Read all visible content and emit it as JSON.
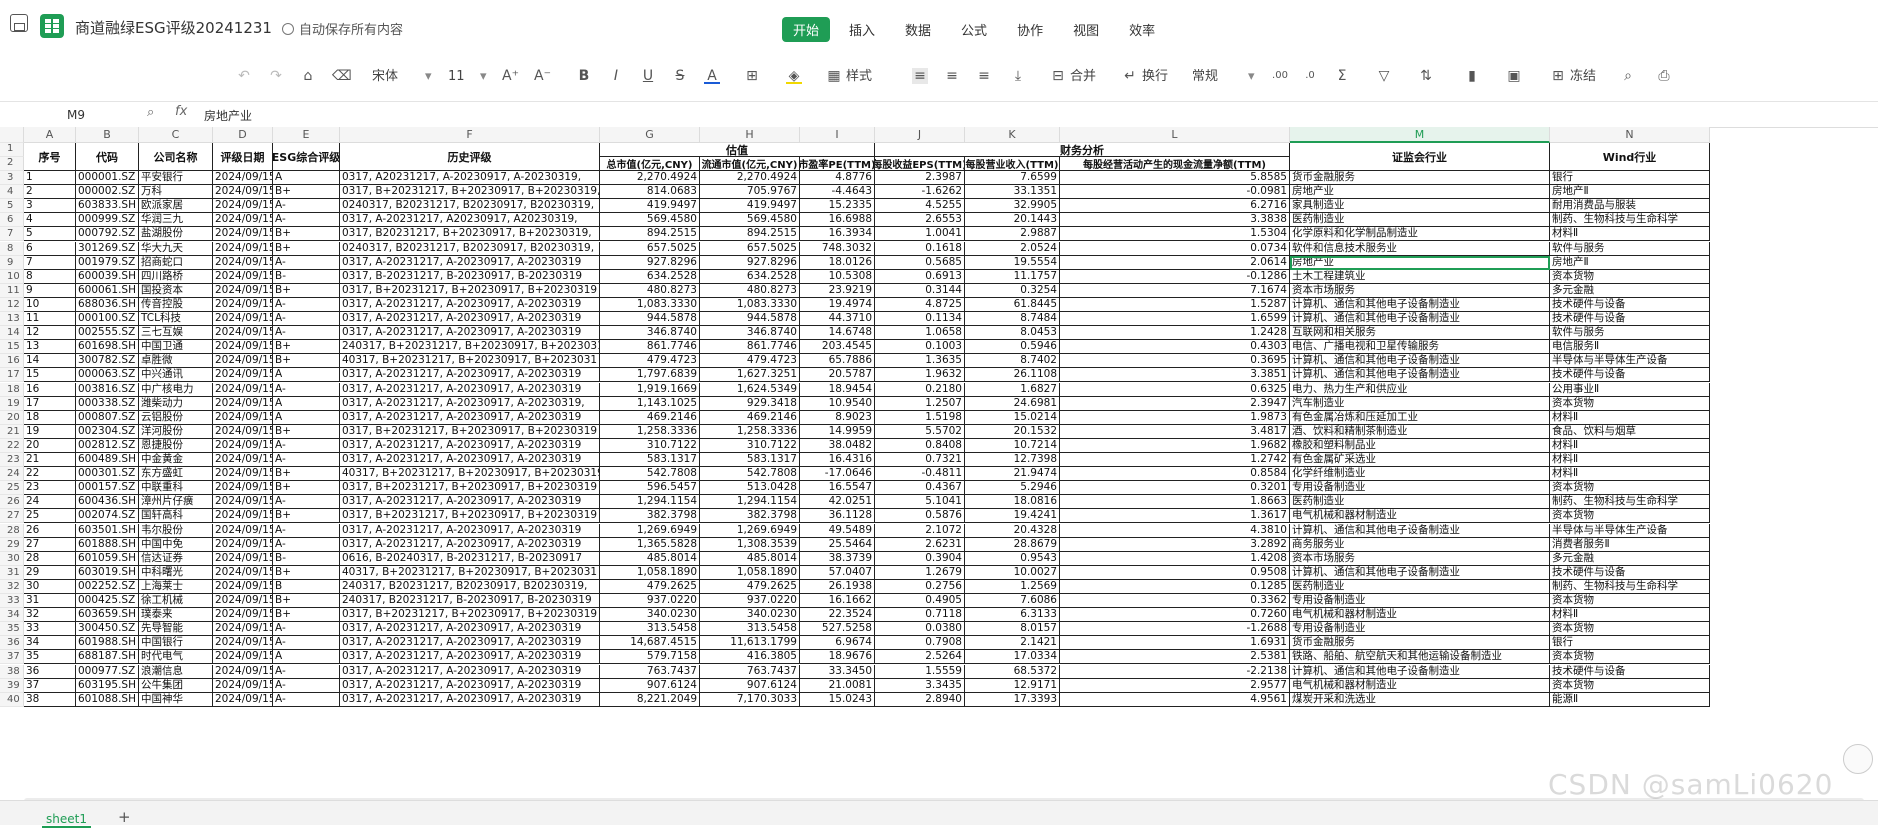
{
  "app": {
    "title": "商道融绿ESG评级20241231",
    "autosave": "自动保存所有内容"
  },
  "menus": [
    "开始",
    "插入",
    "数据",
    "公式",
    "协作",
    "视图",
    "效率"
  ],
  "toolbar": {
    "font": "宋体",
    "size": "11",
    "style": "样式",
    "merge": "合并",
    "wrap": "换行",
    "numfmt": "常规",
    "freeze": "冻结"
  },
  "formula": {
    "cell": "M9",
    "value": "房地产业"
  },
  "sheet": {
    "tab": "sheet1"
  },
  "watermark": "CSDN @samLi0620",
  "columns": [
    "A",
    "B",
    "C",
    "D",
    "E",
    "F",
    "G",
    "H",
    "I",
    "J",
    "K",
    "L",
    "M",
    "N"
  ],
  "group_headers": {
    "valuation": "估值",
    "finance": "财务分析"
  },
  "headers": [
    "序号",
    "代码",
    "公司名称",
    "评级日期",
    "ESG综合评级",
    "历史评级",
    "总市值(亿元,CNY)",
    "流通市值(亿元,CNY)",
    "市盈率PE(TTM)",
    "每股收益EPS(TTM)",
    "每股营业收入(TTM)",
    "每股经营活动产生的现金流量净额(TTM)",
    "证监会行业",
    "Wind行业"
  ],
  "rows": [
    [
      "1",
      "000001.SZ",
      "平安银行",
      "2024/09/15",
      "A",
      "0317, A20231217, A-20230917, A-20230319,",
      "2,270.4924",
      "2,270.4924",
      "4.8776",
      "2.3987",
      "7.6599",
      "5.8585",
      "货币金融服务",
      "银行"
    ],
    [
      "2",
      "000002.SZ",
      "万科",
      "2024/09/15",
      "B+",
      "0317, B+20231217, B+20230917, B+20230319,",
      "814.0683",
      "705.9767",
      "-4.4643",
      "-1.6262",
      "33.1351",
      "-0.0981",
      "房地产业",
      "房地产Ⅱ"
    ],
    [
      "3",
      "603833.SH",
      "欧派家居",
      "2024/09/15",
      "A-",
      "0240317, B20231217, B20230917, B20230319,",
      "419.9497",
      "419.9497",
      "15.2335",
      "4.5255",
      "32.9905",
      "6.2716",
      "家具制造业",
      "耐用消费品与服装"
    ],
    [
      "4",
      "000999.SZ",
      "华润三九",
      "2024/09/15",
      "A-",
      "0317, A-20231217, A20230917, A20230319,",
      "569.4580",
      "569.4580",
      "16.6988",
      "2.6553",
      "20.1443",
      "3.3838",
      "医药制造业",
      "制药、生物科技与生命科学"
    ],
    [
      "5",
      "000792.SZ",
      "盐湖股份",
      "2024/09/15",
      "B+",
      "0317, B20231217, B+20230917, B+20230319,",
      "894.2515",
      "894.2515",
      "16.3934",
      "1.0041",
      "2.9887",
      "1.5304",
      "化学原料和化学制品制造业",
      "材料Ⅱ"
    ],
    [
      "6",
      "301269.SZ",
      "华大九天",
      "2024/09/15",
      "B+",
      "0240317, B20231217, B20230917, B20230319,",
      "657.5025",
      "657.5025",
      "748.3032",
      "0.1618",
      "2.0524",
      "0.0734",
      "软件和信息技术服务业",
      "软件与服务"
    ],
    [
      "7",
      "001979.SZ",
      "招商蛇口",
      "2024/09/15",
      "A-",
      "0317, A-20231217, A-20230917, A-20230319",
      "927.8296",
      "927.8296",
      "18.0126",
      "0.5685",
      "19.5554",
      "2.0614",
      "房地产业",
      "房地产Ⅱ"
    ],
    [
      "8",
      "600039.SH",
      "四川路桥",
      "2024/09/15",
      "B-",
      "0317, B-20231217, B-20230917, B-20230319",
      "634.2528",
      "634.2528",
      "10.5308",
      "0.6913",
      "11.1757",
      "-0.1286",
      "土木工程建筑业",
      "资本货物"
    ],
    [
      "9",
      "600061.SH",
      "国投资本",
      "2024/09/15",
      "B+",
      "0317, B+20231217, B+20230917, B+20230319",
      "480.8273",
      "480.8273",
      "23.9219",
      "0.3144",
      "0.3254",
      "7.1674",
      "资本市场服务",
      "多元金融"
    ],
    [
      "10",
      "688036.SH",
      "传音控股",
      "2024/09/15",
      "A-",
      "0317, A-20231217, A-20230917, A-20230319",
      "1,083.3330",
      "1,083.3330",
      "19.4974",
      "4.8725",
      "61.8445",
      "1.5287",
      "计算机、通信和其他电子设备制造业",
      "技术硬件与设备"
    ],
    [
      "11",
      "000100.SZ",
      "TCL科技",
      "2024/09/15",
      "A-",
      "0317, A-20231217, A-20230917, A-20230319",
      "944.5878",
      "944.5878",
      "44.3710",
      "0.1134",
      "8.7484",
      "1.6599",
      "计算机、通信和其他电子设备制造业",
      "技术硬件与设备"
    ],
    [
      "12",
      "002555.SZ",
      "三七互娱",
      "2024/09/15",
      "A-",
      "0317, A-20231217, A-20230917, A-20230319",
      "346.8740",
      "346.8740",
      "14.6748",
      "1.0658",
      "8.0453",
      "1.2428",
      "互联网和相关服务",
      "软件与服务"
    ],
    [
      "13",
      "601698.SH",
      "中国卫通",
      "2024/09/15",
      "B+",
      "240317, B+20231217, B+20230917, B+20230319",
      "861.7746",
      "861.7746",
      "203.4545",
      "0.1003",
      "0.5946",
      "0.4303",
      "电信、广播电视和卫星传输服务",
      "电信服务Ⅱ"
    ],
    [
      "14",
      "300782.SZ",
      "卓胜微",
      "2024/09/15",
      "B+",
      "40317, B+20231217, B+20230917, B+2023031",
      "479.4723",
      "479.4723",
      "65.7886",
      "1.3635",
      "8.7402",
      "0.3695",
      "计算机、通信和其他电子设备制造业",
      "半导体与半导体生产设备"
    ],
    [
      "15",
      "000063.SZ",
      "中兴通讯",
      "2024/09/15",
      "A",
      "0317, A-20231217, A-20230917, A-20230319",
      "1,797.6839",
      "1,627.3251",
      "20.5787",
      "1.9632",
      "26.1108",
      "3.3851",
      "计算机、通信和其他电子设备制造业",
      "技术硬件与设备"
    ],
    [
      "16",
      "003816.SZ",
      "中广核电力",
      "2024/09/15",
      "A-",
      "0317, A-20231217, A-20230917, A-20230319",
      "1,919.1669",
      "1,624.5349",
      "18.9454",
      "0.2180",
      "1.6827",
      "0.6325",
      "电力、热力生产和供应业",
      "公用事业Ⅱ"
    ],
    [
      "17",
      "000338.SZ",
      "潍柴动力",
      "2024/09/15",
      "A",
      "0317, A-20231217, A-20230917, A-20230319,",
      "1,143.1025",
      "929.3418",
      "10.9540",
      "1.2507",
      "24.6981",
      "2.3947",
      "汽车制造业",
      "资本货物"
    ],
    [
      "18",
      "000807.SZ",
      "云铝股份",
      "2024/09/15",
      "A",
      "0317, A-20231217, A-20230917, A-20230319",
      "469.2146",
      "469.2146",
      "8.9023",
      "1.5198",
      "15.0214",
      "1.9873",
      "有色金属冶炼和压延加工业",
      "材料Ⅱ"
    ],
    [
      "19",
      "002304.SZ",
      "洋河股份",
      "2024/09/15",
      "B+",
      "0317, B+20231217, B+20230917, B+20230319",
      "1,258.3336",
      "1,258.3336",
      "14.9959",
      "5.5702",
      "20.1532",
      "3.4817",
      "酒、饮料和精制茶制造业",
      "食品、饮料与烟草"
    ],
    [
      "20",
      "002812.SZ",
      "恩捷股份",
      "2024/09/15",
      "A-",
      "0317, A-20231217, A-20230917, A-20230319",
      "310.7122",
      "310.7122",
      "38.0482",
      "0.8408",
      "10.7214",
      "1.9682",
      "橡胶和塑料制品业",
      "材料Ⅱ"
    ],
    [
      "21",
      "600489.SH",
      "中金黄金",
      "2024/09/15",
      "A-",
      "0317, A-20231217, A-20230917, A-20230319",
      "583.1317",
      "583.1317",
      "16.4316",
      "0.7321",
      "12.7398",
      "1.2742",
      "有色金属矿采选业",
      "材料Ⅱ"
    ],
    [
      "22",
      "000301.SZ",
      "东方盛虹",
      "2024/09/15",
      "B+",
      "40317, B+20231217, B+20230917, B+20230319",
      "542.7808",
      "542.7808",
      "-17.0646",
      "-0.4811",
      "21.9474",
      "0.8584",
      "化学纤维制造业",
      "材料Ⅱ"
    ],
    [
      "23",
      "000157.SZ",
      "中联重科",
      "2024/09/15",
      "B+",
      "0317, B+20231217, B+20230917, B+20230319",
      "596.5457",
      "513.0428",
      "16.5547",
      "0.4367",
      "5.2946",
      "0.3201",
      "专用设备制造业",
      "资本货物"
    ],
    [
      "24",
      "600436.SH",
      "漳州片仔癀",
      "2024/09/15",
      "A-",
      "0317, A-20231217, A-20230917, A-20230319",
      "1,294.1154",
      "1,294.1154",
      "42.0251",
      "5.1041",
      "18.0816",
      "1.8663",
      "医药制造业",
      "制药、生物科技与生命科学"
    ],
    [
      "25",
      "002074.SZ",
      "国轩高科",
      "2024/09/15",
      "B+",
      "0317, B+20231217, B+20230917, B+20230319",
      "382.3798",
      "382.3798",
      "36.1128",
      "0.5876",
      "19.4241",
      "1.3617",
      "电气机械和器材制造业",
      "资本货物"
    ],
    [
      "26",
      "603501.SH",
      "韦尔股份",
      "2024/09/15",
      "A-",
      "0317, A-20231217, A-20230917, A-20230319",
      "1,269.6949",
      "1,269.6949",
      "49.5489",
      "2.1072",
      "20.4328",
      "4.3810",
      "计算机、通信和其他电子设备制造业",
      "半导体与半导体生产设备"
    ],
    [
      "27",
      "601888.SH",
      "中国中免",
      "2024/09/15",
      "A-",
      "0317, A-20231217, A-20230917, A-20230319",
      "1,365.5828",
      "1,308.3539",
      "25.5464",
      "2.6231",
      "28.8679",
      "3.2892",
      "商务服务业",
      "消费者服务Ⅱ"
    ],
    [
      "28",
      "601059.SH",
      "信达证券",
      "2024/09/15",
      "B-",
      "0616, B-20240317, B-20231217, B-20230917",
      "485.8014",
      "485.8014",
      "38.3739",
      "0.3904",
      "0.9543",
      "1.4208",
      "资本市场服务",
      "多元金融"
    ],
    [
      "29",
      "603019.SH",
      "中科曙光",
      "2024/09/15",
      "B+",
      "40317, B+20231217, B+20230917, B+2023031",
      "1,058.1890",
      "1,058.1890",
      "57.0407",
      "1.2679",
      "10.0027",
      "0.9508",
      "计算机、通信和其他电子设备制造业",
      "技术硬件与设备"
    ],
    [
      "30",
      "002252.SZ",
      "上海莱士",
      "2024/09/15",
      "B",
      "240317, B20231217, B20230917, B20230319,",
      "479.2625",
      "479.2625",
      "26.1938",
      "0.2756",
      "1.2569",
      "0.1285",
      "医药制造业",
      "制药、生物科技与生命科学"
    ],
    [
      "31",
      "000425.SZ",
      "徐工机械",
      "2024/09/15",
      "B+",
      "240317, B20231217, B-20230917, B-20230319",
      "937.0220",
      "937.0220",
      "16.1662",
      "0.4905",
      "7.6086",
      "0.3362",
      "专用设备制造业",
      "资本货物"
    ],
    [
      "32",
      "603659.SH",
      "璞泰来",
      "2024/09/15",
      "B+",
      "0317, B+20231217, B+20230917, B+20230319",
      "340.0230",
      "340.0230",
      "22.3524",
      "0.7118",
      "6.3133",
      "0.7260",
      "电气机械和器材制造业",
      "材料Ⅱ"
    ],
    [
      "33",
      "300450.SZ",
      "先导智能",
      "2024/09/15",
      "A-",
      "0317, A-20231217, A-20230917, A-20230319",
      "313.5458",
      "313.5458",
      "527.5258",
      "0.0380",
      "8.0157",
      "-1.2688",
      "专用设备制造业",
      "资本货物"
    ],
    [
      "34",
      "601988.SH",
      "中国银行",
      "2024/09/15",
      "A-",
      "0317, A-20231217, A-20230917, A-20230319",
      "14,687.4515",
      "11,613.1799",
      "6.9674",
      "0.7908",
      "2.1421",
      "1.6931",
      "货币金融服务",
      "银行"
    ],
    [
      "35",
      "688187.SH",
      "时代电气",
      "2024/09/15",
      "A",
      "0317, A-20231217, A-20230917, A-20230319",
      "579.7158",
      "416.3805",
      "18.9676",
      "2.5264",
      "17.0334",
      "2.5381",
      "铁路、船舶、航空航天和其他运输设备制造业",
      "资本货物"
    ],
    [
      "36",
      "000977.SZ",
      "浪潮信息",
      "2024/09/15",
      "A-",
      "0317, A-20231217, A-20230917, A-20230319",
      "763.7437",
      "763.7437",
      "33.3450",
      "1.5559",
      "68.5372",
      "-2.2138",
      "计算机、通信和其他电子设备制造业",
      "技术硬件与设备"
    ],
    [
      "37",
      "603195.SH",
      "公牛集团",
      "2024/09/15",
      "A-",
      "0317, A-20231217, A-20230917, A-20230319",
      "907.6124",
      "907.6124",
      "21.0081",
      "3.3435",
      "12.9171",
      "2.9577",
      "电气机械和器材制造业",
      "资本货物"
    ],
    [
      "38",
      "601088.SH",
      "中国神华",
      "2024/09/15",
      "A-",
      "0317, A-20231217, A-20230917, A-20230319",
      "8,221.2049",
      "7,170.3033",
      "15.0243",
      "2.8940",
      "17.3393",
      "4.9561",
      "煤炭开采和洗选业",
      "能源Ⅱ"
    ]
  ]
}
